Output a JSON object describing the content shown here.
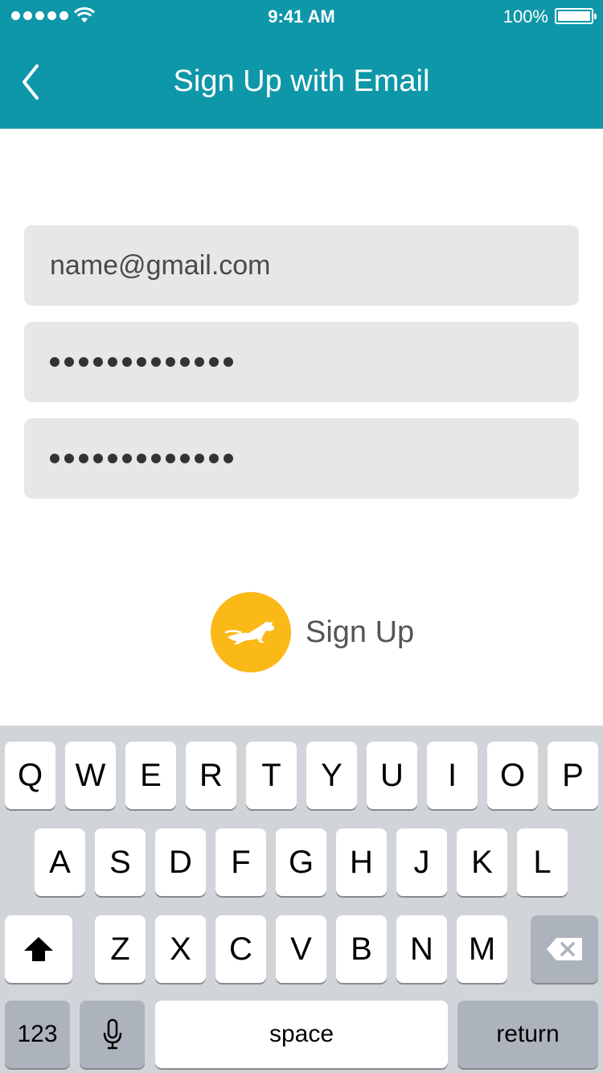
{
  "status_bar": {
    "time": "9:41 AM",
    "battery": "100%"
  },
  "header": {
    "title": "Sign Up with Email"
  },
  "form": {
    "email_value": "name@gmail.com",
    "password_mask": "•••••••••••••",
    "confirm_mask": "•••••••••••••"
  },
  "signup": {
    "label": "Sign Up"
  },
  "keyboard": {
    "row1": [
      "Q",
      "W",
      "E",
      "R",
      "T",
      "Y",
      "U",
      "I",
      "O",
      "P"
    ],
    "row2": [
      "A",
      "S",
      "D",
      "F",
      "G",
      "H",
      "J",
      "K",
      "L"
    ],
    "row3": [
      "Z",
      "X",
      "C",
      "V",
      "B",
      "N",
      "M"
    ],
    "numbers_label": "123",
    "space_label": "space",
    "return_label": "return"
  },
  "colors": {
    "header": "#0e97a9",
    "accent": "#fbb918",
    "field": "#e6e7e9",
    "keyboard_bg": "#d1d4d9"
  },
  "icons": [
    "signal-icon",
    "wifi-icon",
    "battery-icon",
    "back-chevron-icon",
    "running-dog-icon",
    "shift-icon",
    "microphone-icon",
    "backspace-icon"
  ]
}
